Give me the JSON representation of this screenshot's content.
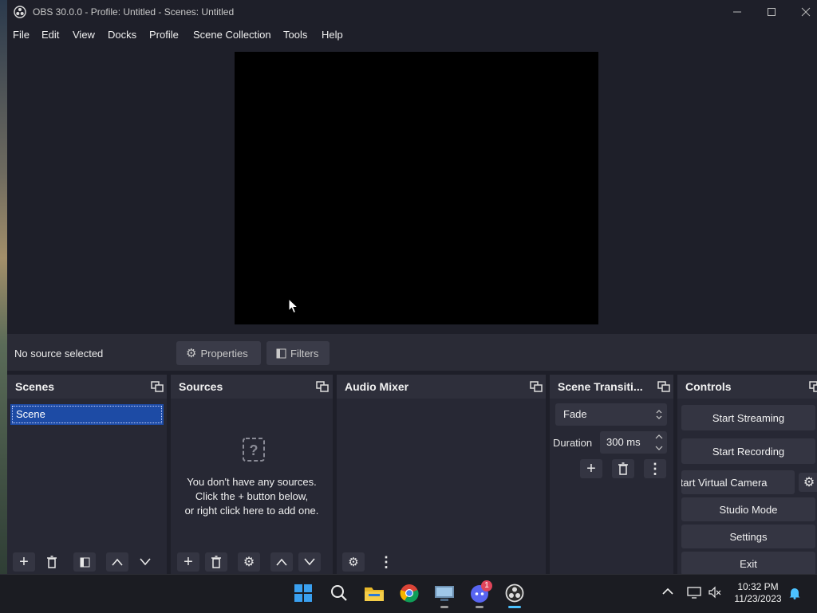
{
  "window": {
    "title": "OBS 30.0.0 - Profile: Untitled - Scenes: Untitled"
  },
  "menu": [
    "File",
    "Edit",
    "View",
    "Docks",
    "Profile",
    "Scene Collection",
    "Tools",
    "Help"
  ],
  "source_toolbar": {
    "status": "No source selected",
    "properties_label": "Properties",
    "filters_label": "Filters"
  },
  "scenes": {
    "title": "Scenes",
    "items": [
      "Scene"
    ]
  },
  "sources": {
    "title": "Sources",
    "empty_line1": "You don't have any sources.",
    "empty_line2": "Click the + button below,",
    "empty_line3": "or right click here to add one."
  },
  "audio_mixer": {
    "title": "Audio Mixer"
  },
  "transitions": {
    "title": "Scene Transiti...",
    "selected": "Fade",
    "duration_label": "Duration",
    "duration_value": "300 ms"
  },
  "controls": {
    "title": "Controls",
    "start_streaming": "Start Streaming",
    "start_recording": "Start Recording",
    "start_virtual_camera": "Start Virtual Camera",
    "studio_mode": "Studio Mode",
    "settings": "Settings",
    "exit": "Exit"
  },
  "taskbar": {
    "time": "10:32 PM",
    "date": "11/23/2023",
    "discord_badge": "1"
  },
  "colors": {
    "accent": "#1d4ba5",
    "dock_bg": "#272834",
    "window_bg": "#1e1f29"
  }
}
